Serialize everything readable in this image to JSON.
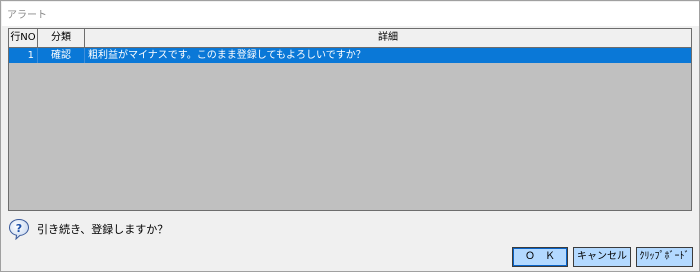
{
  "window": {
    "title": "アラート"
  },
  "grid": {
    "columns": [
      "行NO",
      "分類",
      "詳細"
    ],
    "rows": [
      {
        "no": "1",
        "type": "確認",
        "detail": "粗利益がマイナスです。このまま登録してもよろしいですか？"
      }
    ]
  },
  "prompt": {
    "icon": "question-icon",
    "text": "引き続き、登録しますか？"
  },
  "buttons": {
    "ok": "Ｏ　Ｋ",
    "cancel": "キャンセル",
    "clipboard": "ｸﾘｯﾌﾟﾎﾞｰﾄﾞ"
  },
  "colors": {
    "selection": "#0a78d7",
    "grid_background": "#c0c0c0",
    "button": "#b3d9ff"
  }
}
